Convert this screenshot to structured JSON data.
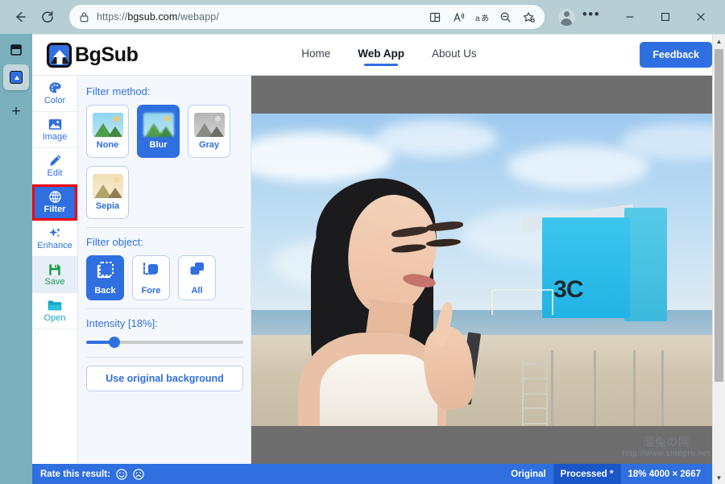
{
  "browser": {
    "url_prefix": "https://",
    "url_domain": "bgsub.com",
    "url_path": "/webapp/",
    "back_icon": "back-arrow-icon",
    "reload_icon": "reload-icon",
    "lock_icon": "lock-icon",
    "toolbar_icons": [
      "split-screen-icon",
      "read-aloud-icon",
      "translate-icon",
      "zoom-out-icon",
      "add-favorite-icon"
    ],
    "profile_icon": "profile-avatar-icon",
    "more_label": "•••",
    "minimize_label": "─",
    "maximize_label": "□",
    "close_label": "✕",
    "tabstrip": {
      "tab_list_icon": "tab-list-icon",
      "active_tab_icon": "bgsub-favicon",
      "new_tab_label": "+"
    }
  },
  "site": {
    "logo_text": "BgSub",
    "nav": [
      {
        "label": "Home",
        "active": false
      },
      {
        "label": "Web App",
        "active": true
      },
      {
        "label": "About Us",
        "active": false
      }
    ],
    "feedback_label": "Feedback"
  },
  "tools": [
    {
      "label": "Color",
      "icon": "palette-icon",
      "color": "blue",
      "state": "normal"
    },
    {
      "label": "Image",
      "icon": "picture-icon",
      "color": "blue",
      "state": "normal"
    },
    {
      "label": "Edit",
      "icon": "pencil-icon",
      "color": "blue",
      "state": "normal"
    },
    {
      "label": "Filter",
      "icon": "globe-grid-icon",
      "color": "blue",
      "state": "selected"
    },
    {
      "label": "Enhance",
      "icon": "sparkle-icon",
      "color": "blue",
      "state": "normal"
    },
    {
      "label": "Save",
      "icon": "floppy-icon",
      "color": "green",
      "state": "hover"
    },
    {
      "label": "Open",
      "icon": "folder-icon",
      "color": "teal",
      "state": "normal"
    }
  ],
  "panel": {
    "filter_method_title": "Filter method:",
    "methods": [
      {
        "label": "None",
        "selected": false
      },
      {
        "label": "Blur",
        "selected": true
      },
      {
        "label": "Gray",
        "selected": false
      },
      {
        "label": "Sepia",
        "selected": false
      }
    ],
    "filter_object_title": "Filter object:",
    "objects": [
      {
        "label": "Back",
        "selected": true
      },
      {
        "label": "Fore",
        "selected": false
      },
      {
        "label": "All",
        "selected": false
      }
    ],
    "intensity_label": "Intensity [18%]:",
    "intensity_value": 18,
    "use_original_label": "Use original background"
  },
  "canvas": {
    "tower_number": "3C",
    "watermark_cjk": "溜兔の网",
    "watermark_url": "http://www.sinopro.net"
  },
  "statusbar": {
    "rate_label": "Rate this result:",
    "happy_icon": "happy-face-icon",
    "sad_icon": "sad-face-icon",
    "original_label": "Original",
    "processed_label": "Processed *",
    "zoom_dimensions": "18% 4000 × 2667"
  },
  "colors": {
    "accent": "#2f6fe0",
    "accent_dark": "#1b56c9",
    "highlight_outline": "#f4000c",
    "save_green": "#179b49",
    "open_teal": "#13a5c4",
    "chrome_bg": "#b6ced4",
    "tabstrip_bg": "#7bb0bd",
    "canvas_bg": "#6e6e6e",
    "panel_bg": "#f4f8fd"
  }
}
